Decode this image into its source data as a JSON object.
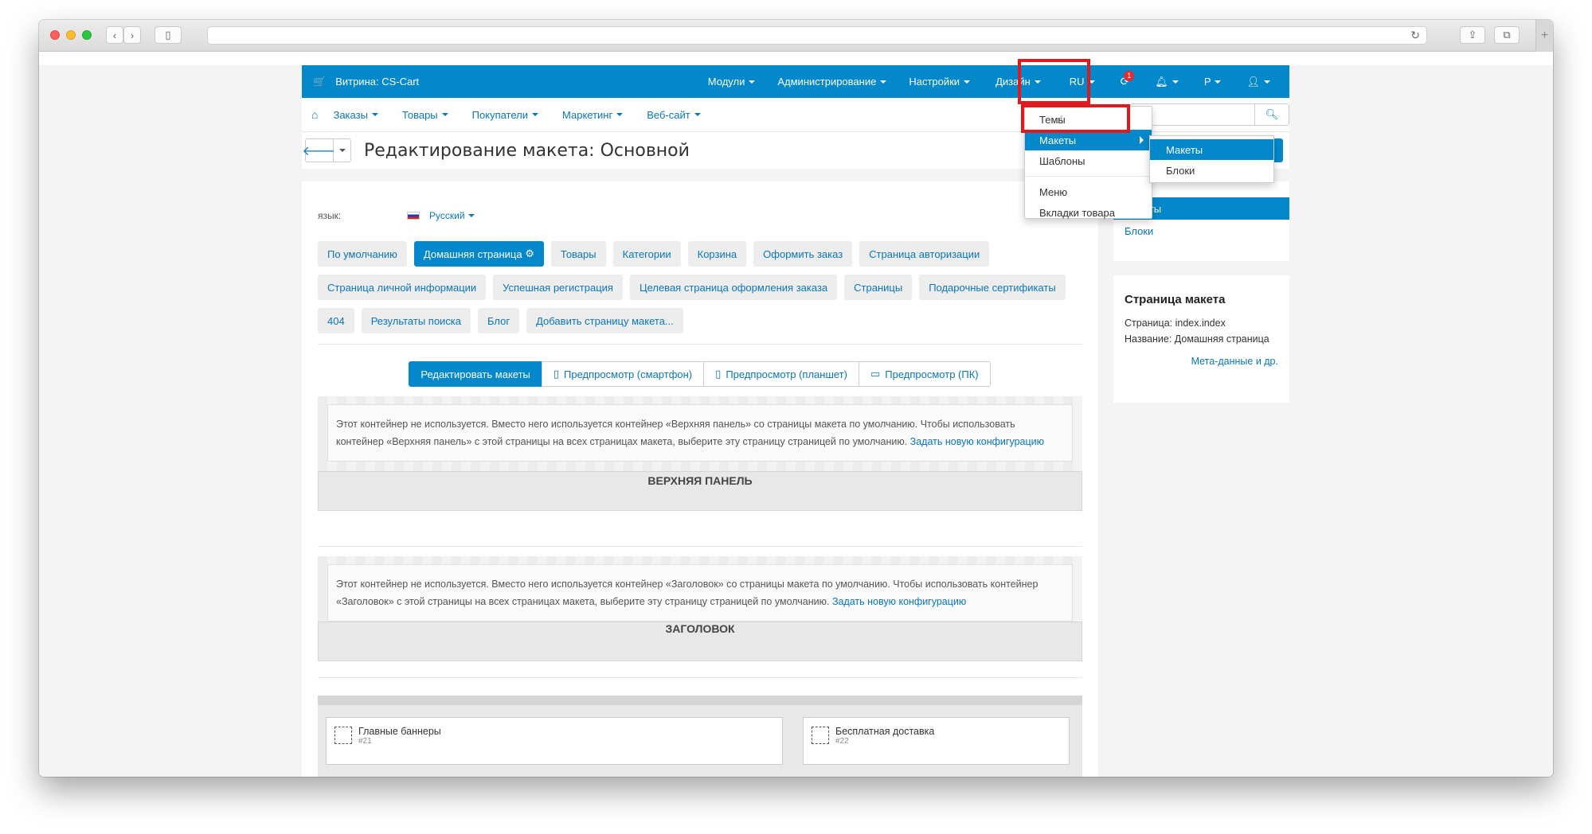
{
  "topnav": {
    "brand": "Витрина: CS-Cart",
    "menu": [
      {
        "label": "Модули"
      },
      {
        "label": "Администрирование"
      },
      {
        "label": "Настройки"
      },
      {
        "label": "Дизайн"
      },
      {
        "label": "RU"
      },
      {
        "label": "notifications",
        "badge": "1"
      },
      {
        "label": "bell"
      },
      {
        "label": "Р"
      },
      {
        "label": "user"
      }
    ]
  },
  "secnav": {
    "items": [
      "Заказы",
      "Товары",
      "Покупатели",
      "Маркетинг",
      "Веб-сайт"
    ]
  },
  "title": "Редактирование макета: Основной",
  "lang": {
    "label": "язык:",
    "value": "Русский"
  },
  "chips": [
    "По умолчанию",
    "Домашняя страница",
    "Товары",
    "Категории",
    "Корзина",
    "Оформить заказ",
    "Страница авторизации",
    "Страница личной информации",
    "Успешная регистрация",
    "Целевая страница оформления заказа",
    "Страницы",
    "Подарочные сертификаты",
    "404",
    "Результаты поиска",
    "Блог",
    "Добавить страницу макета..."
  ],
  "viewtabs": [
    "Редактировать макеты",
    "Предпросмотр (смартфон)",
    "Предпросмотр (планшет)",
    "Предпросмотр (ПК)"
  ],
  "containers": [
    {
      "notice": "Этот контейнер не используется. Вместо него используется контейнер «Верхняя панель» со страницы макета по умолчанию. Чтобы использовать контейнер «Верхняя панель» с этой страницы на всех страницах макета, выберите эту страницу страницей по умолчанию.",
      "link": "Задать новую конфигурацию",
      "title": "ВЕРХНЯЯ ПАНЕЛЬ"
    },
    {
      "notice": "Этот контейнер не используется. Вместо него используется контейнер «Заголовок» со страницы макета по умолчанию. Чтобы использовать контейнер «Заголовок» с этой страницы на всех страницах макета, выберите эту страницу страницей по умолчанию.",
      "link": "Задать новую конфигурацию",
      "title": "ЗАГОЛОВОК"
    }
  ],
  "blocks": [
    {
      "name": "Главные баннеры",
      "id": "#21"
    },
    {
      "name": "Бесплатная доставка",
      "id": "#22"
    }
  ],
  "sidebar": {
    "nav": [
      "Макеты",
      "Блоки"
    ],
    "info_title": "Страница макета",
    "page_line": "Страница: index.index",
    "name_line": "Название: Домашняя страница",
    "meta_link": "Мета-данные и др."
  },
  "design_dropdown": {
    "items": [
      "Темы",
      "Макеты",
      "Шаблоны",
      "Меню",
      "Вкладки товара"
    ],
    "highlighted": "Макеты"
  },
  "submenu": {
    "items": [
      "Макеты",
      "Блоки"
    ],
    "highlighted": "Макеты"
  },
  "colors": {
    "accent": "#0388cc",
    "link": "#0a76bd",
    "highlight_box": "#e0191f"
  }
}
